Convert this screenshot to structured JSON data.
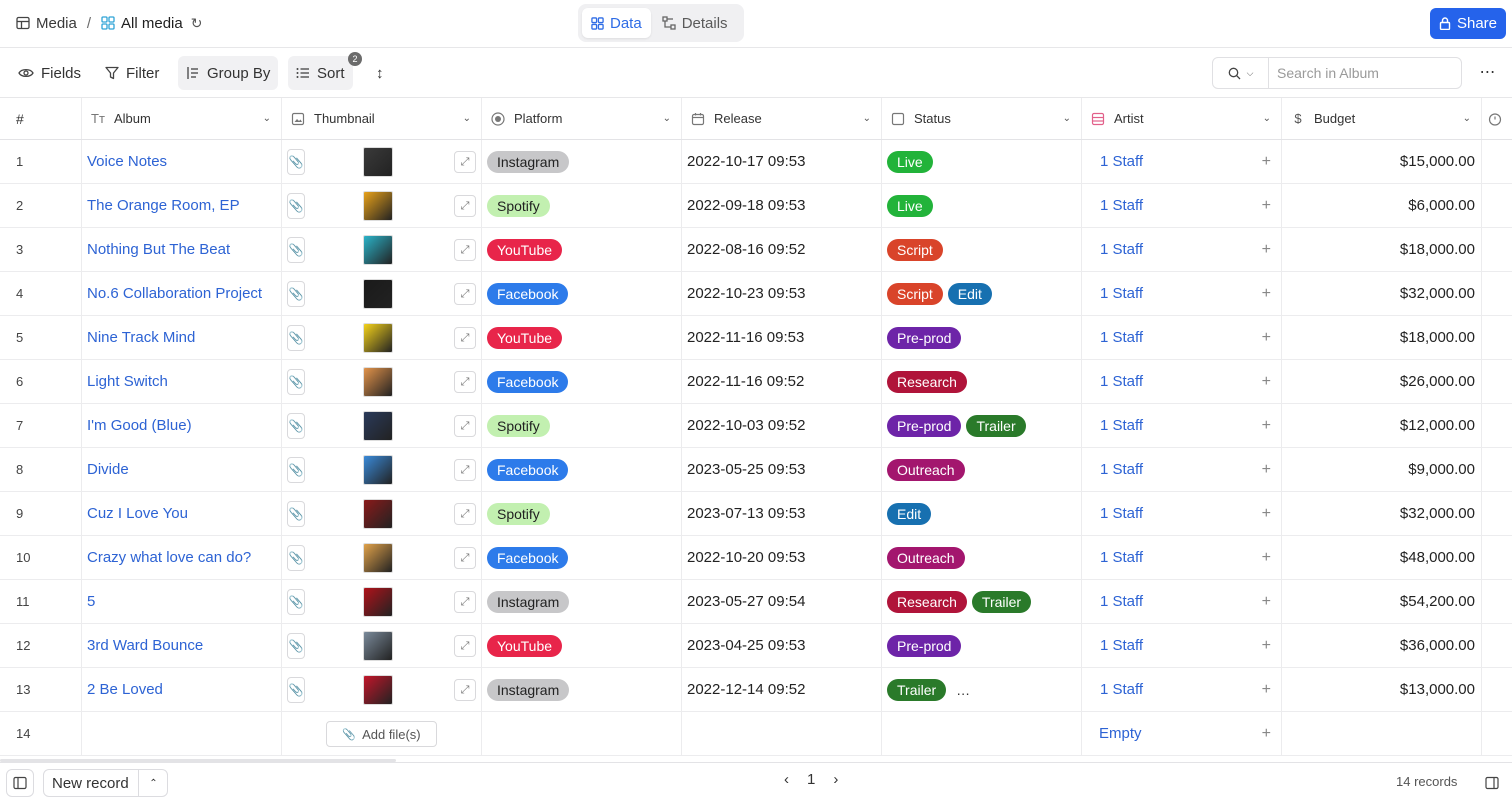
{
  "header": {
    "breadcrumb_base": "Media",
    "breadcrumb_sep": "/",
    "view_name": "All media",
    "tabs": [
      {
        "label": "Data",
        "active": true
      },
      {
        "label": "Details",
        "active": false
      }
    ],
    "share_label": "Share"
  },
  "toolbar": {
    "fields_label": "Fields",
    "filter_label": "Filter",
    "group_by_label": "Group By",
    "sort_label": "Sort",
    "sort_badge": "2",
    "search_placeholder": "Search in Album"
  },
  "columns": [
    {
      "key": "num",
      "label": "#",
      "icon": "hash"
    },
    {
      "key": "album",
      "label": "Album",
      "icon": "text-icon"
    },
    {
      "key": "thumbnail",
      "label": "Thumbnail",
      "icon": "image-icon"
    },
    {
      "key": "platform",
      "label": "Platform",
      "icon": "radio-icon"
    },
    {
      "key": "release",
      "label": "Release",
      "icon": "calendar-icon"
    },
    {
      "key": "status",
      "label": "Status",
      "icon": "checkbox-icon"
    },
    {
      "key": "artist",
      "label": "Artist",
      "icon": "link-icon"
    },
    {
      "key": "budget",
      "label": "Budget",
      "icon": "dollar-icon"
    }
  ],
  "colors": {
    "Instagram": "#c7c7c9",
    "Spotify": "#c2f0b0",
    "YouTube": "#e8254a",
    "Facebook": "#2d7bea",
    "Live": "#22b33a",
    "Script": "#d9442a",
    "Edit": "#1770b0",
    "Pre-prod": "#6d24a8",
    "Research": "#b0143a",
    "Trailer": "#2a7a2a",
    "Outreach": "#a3166e"
  },
  "rows": [
    {
      "num": "1",
      "album": "Voice Notes",
      "thumb_color": "#3a3a3a",
      "platform": "Instagram",
      "release": "2022-10-17 09:53",
      "status": [
        "Live"
      ],
      "artist": "1 Staff",
      "budget": "$15,000.00"
    },
    {
      "num": "2",
      "album": "The Orange Room, EP",
      "thumb_color": "#e8a21a",
      "platform": "Spotify",
      "release": "2022-09-18 09:53",
      "status": [
        "Live"
      ],
      "artist": "1 Staff",
      "budget": "$6,000.00"
    },
    {
      "num": "3",
      "album": "Nothing But The Beat",
      "thumb_color": "#2bb3c9",
      "platform": "YouTube",
      "release": "2022-08-16 09:52",
      "status": [
        "Script"
      ],
      "artist": "1 Staff",
      "budget": "$18,000.00"
    },
    {
      "num": "4",
      "album": "No.6 Collaboration Project",
      "thumb_color": "#1a1a1a",
      "platform": "Facebook",
      "release": "2022-10-23 09:53",
      "status": [
        "Script",
        "Edit"
      ],
      "artist": "1 Staff",
      "budget": "$32,000.00"
    },
    {
      "num": "5",
      "album": "Nine Track Mind",
      "thumb_color": "#f4d21a",
      "platform": "YouTube",
      "release": "2022-11-16 09:53",
      "status": [
        "Pre-prod"
      ],
      "artist": "1 Staff",
      "budget": "$18,000.00"
    },
    {
      "num": "6",
      "album": "Light Switch",
      "thumb_color": "#e2934a",
      "platform": "Facebook",
      "release": "2022-11-16 09:52",
      "status": [
        "Research"
      ],
      "artist": "1 Staff",
      "budget": "$26,000.00"
    },
    {
      "num": "7",
      "album": "I'm Good (Blue)",
      "thumb_color": "#2a3a5a",
      "platform": "Spotify",
      "release": "2022-10-03 09:52",
      "status": [
        "Pre-prod",
        "Trailer"
      ],
      "artist": "1 Staff",
      "budget": "$12,000.00"
    },
    {
      "num": "8",
      "album": "Divide",
      "thumb_color": "#3a8ad8",
      "platform": "Facebook",
      "release": "2023-05-25 09:53",
      "status": [
        "Outreach"
      ],
      "artist": "1 Staff",
      "budget": "$9,000.00"
    },
    {
      "num": "9",
      "album": "Cuz I Love You",
      "thumb_color": "#8a1a1a",
      "platform": "Spotify",
      "release": "2023-07-13 09:53",
      "status": [
        "Edit"
      ],
      "artist": "1 Staff",
      "budget": "$32,000.00"
    },
    {
      "num": "10",
      "album": "Crazy what love can do?",
      "thumb_color": "#e0a24a",
      "platform": "Facebook",
      "release": "2022-10-20 09:53",
      "status": [
        "Outreach"
      ],
      "artist": "1 Staff",
      "budget": "$48,000.00"
    },
    {
      "num": "11",
      "album": "5",
      "thumb_color": "#b0121a",
      "platform": "Instagram",
      "release": "2023-05-27 09:54",
      "status": [
        "Research",
        "Trailer"
      ],
      "artist": "1 Staff",
      "budget": "$54,200.00"
    },
    {
      "num": "12",
      "album": "3rd Ward Bounce",
      "thumb_color": "#7a8a9a",
      "platform": "YouTube",
      "release": "2023-04-25 09:53",
      "status": [
        "Pre-prod"
      ],
      "artist": "1 Staff",
      "budget": "$36,000.00"
    },
    {
      "num": "13",
      "album": "2 Be Loved",
      "thumb_color": "#c2162a",
      "platform": "Instagram",
      "release": "2022-12-14 09:52",
      "status": [
        "Trailer",
        "…"
      ],
      "artist": "1 Staff",
      "budget": "$13,000.00"
    }
  ],
  "empty_row": {
    "num": "14",
    "add_files_label": "Add file(s)",
    "artist_label": "Empty"
  },
  "footer": {
    "new_record_label": "New record",
    "page": "1",
    "records_count": "14 records"
  }
}
